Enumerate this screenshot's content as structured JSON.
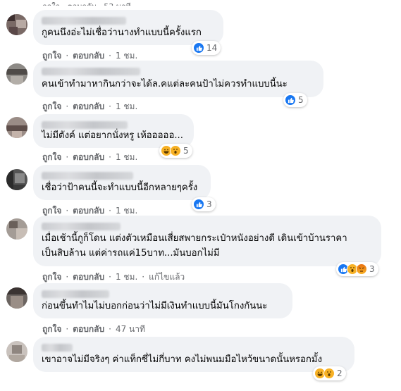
{
  "actions": {
    "like": "ถูกใจ",
    "reply": "ตอบกลับ",
    "edited": "แก้ไขแล้ว",
    "separator": "·"
  },
  "top_partial": "ถูกใจ · ตอบกลับ · 53 นาที",
  "comments": [
    {
      "text": [
        "กูคนนึงอ่ะไม่เชื่อว่านางทำแบบนี้ครั้งแรก"
      ],
      "time": "1 ชม.",
      "reaction_count": "14",
      "reactions": [
        "like-icon"
      ]
    },
    {
      "text": [
        "คนเข้าทำมาหากินกว่าจะได้ล.คแต่ละคนป้าไม่ควรทำแบบนี้นะ"
      ],
      "time": "1 ชม.",
      "reaction_count": "5",
      "reactions": [
        "like-icon"
      ]
    },
    {
      "text": [
        "ไม่มีตังค์ แต่อยากนั่งหรู เห้อออออ..."
      ],
      "time": "1 ชม.",
      "reaction_count": "5",
      "reactions": [
        "haha-icon",
        "wow-icon"
      ]
    },
    {
      "text": [
        "เชื่อว่าป้าคนนี้จะทำแบบนี้อีกหลายๆครั้ง"
      ],
      "time": "1 ชม.",
      "reaction_count": "3",
      "reactions": [
        "like-icon"
      ]
    },
    {
      "text": [
        "เมื่อเช้านี้กูก็โดน แต่งตัวเหมือนเสี่ยสพายกระเป๋าหนังอย่างดี เดินเข้าบ้านราคา",
        "เป็นสิบล้าน แต่ค่ารถแค่15บาท...มันบอกไม่มี"
      ],
      "time": "1 ชม.",
      "edited": true,
      "reaction_count": "3",
      "reactions": [
        "like-icon",
        "wow-icon",
        "angry-icon"
      ]
    },
    {
      "text": [
        "ก่อนขึ้นทำไมไม่บอกก่อนว่าไม่มีเงินทำแบบนี้มันโกงกันนะ"
      ],
      "time": "47 นาที",
      "reaction_count": "",
      "reactions": []
    },
    {
      "text": [
        "เขาอาจไม่มีจริงๆ ค่าแท็กซี่ไม่กี่บาท คงไม่พนมมือไหว้ขนาดนั้นหรอกมั้ง"
      ],
      "time": "",
      "reaction_count": "2",
      "reactions": [
        "haha-icon",
        "wow-icon"
      ]
    }
  ],
  "colors": {
    "bubble": "#f0f2f5",
    "meta": "#65676b",
    "like": "#1877f2",
    "haha": "#f7b125"
  }
}
